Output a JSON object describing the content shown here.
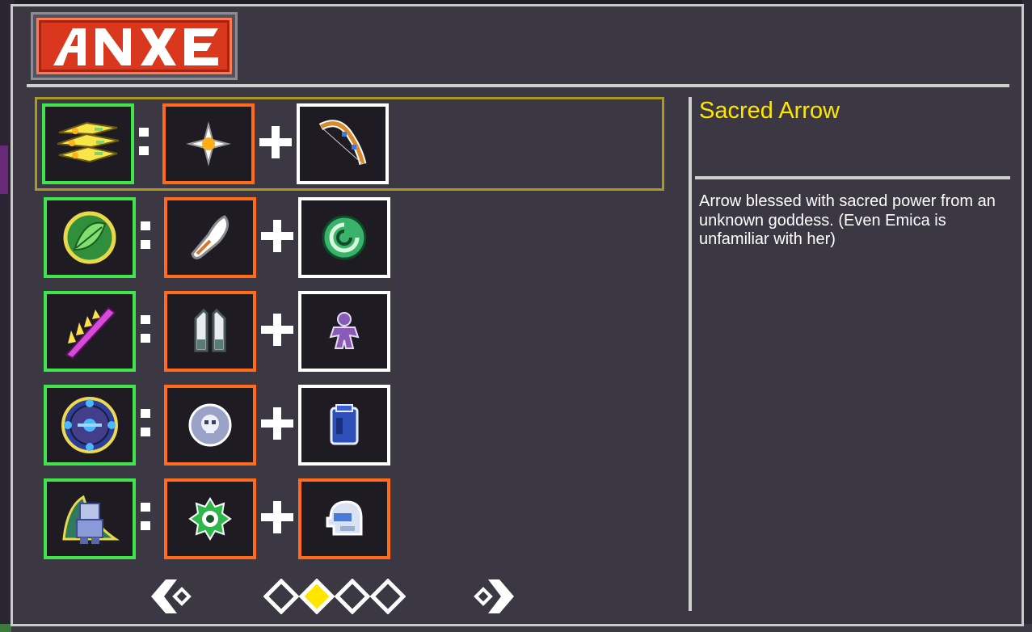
{
  "logo_text": "ANXE",
  "selected_item": {
    "name": "Sacred Arrow",
    "description": "Arrow blessed with sacred power from an unknown goddess. (Even Emica is unfamiliar with her)"
  },
  "recipes": [
    {
      "result": "sacred-arrow-icon",
      "ingredient_a": "holy-star-icon",
      "ingredient_b": "bow-icon",
      "selected": true
    },
    {
      "result": "leaf-orb-icon",
      "ingredient_a": "feather-icon",
      "ingredient_b": "green-shell-icon",
      "selected": false
    },
    {
      "result": "pink-blade-icon",
      "ingredient_a": "twin-crystals-icon",
      "ingredient_b": "purple-doll-icon",
      "selected": false
    },
    {
      "result": "blue-sigil-icon",
      "ingredient_a": "skull-orb-icon",
      "ingredient_b": "blue-jar-icon",
      "selected": false
    },
    {
      "result": "armor-figure-icon",
      "ingredient_a": "green-gear-icon",
      "ingredient_b": "ghost-helmet-icon",
      "selected": false
    }
  ],
  "pagination": {
    "total_pages": 4,
    "current_page": 2
  },
  "colors": {
    "result_border": "#3fe54a",
    "ingredient_border": "#ff6b1a",
    "common_border": "#ffffff",
    "title": "#ffe600",
    "selected_outline": "#aa9a25"
  }
}
